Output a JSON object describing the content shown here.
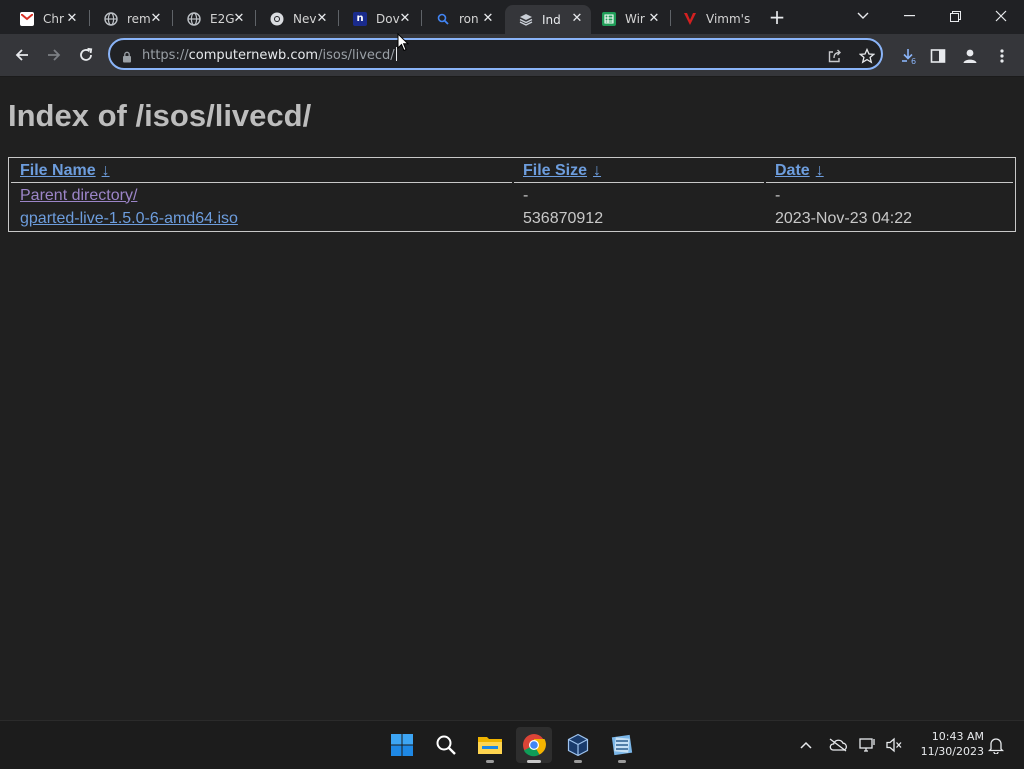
{
  "browser": {
    "tabs": [
      {
        "label": "Chr",
        "icon": "gmail-icon",
        "active": false
      },
      {
        "label": "rem",
        "icon": "globe-icon",
        "active": false
      },
      {
        "label": "E2G",
        "icon": "globe-icon",
        "active": false
      },
      {
        "label": "Nev",
        "icon": "chrome-icon",
        "active": false
      },
      {
        "label": "Dov",
        "icon": "n-logo-icon",
        "active": false
      },
      {
        "label": "ron",
        "icon": "search-icon",
        "active": false
      },
      {
        "label": "Ind",
        "icon": "site-icon",
        "active": true
      },
      {
        "label": "Wir",
        "icon": "sheet-icon",
        "active": false
      },
      {
        "label": "Vimm's",
        "icon": "vimm-icon",
        "active": false
      }
    ],
    "url_host": "computernewb.com",
    "url_scheme": "https://",
    "url_path": "/isos/livecd/",
    "download_badge": "6"
  },
  "page": {
    "title": "Index of /isos/livecd/",
    "columns": {
      "name": "File Name",
      "size": "File Size",
      "date": "Date",
      "sort_arrow": "↓"
    },
    "rows": [
      {
        "name": "Parent directory/",
        "size": "-",
        "date": "-",
        "visited": true
      },
      {
        "name": "gparted-live-1.5.0-6-amd64.iso",
        "size": "536870912",
        "date": "2023-Nov-23 04:22",
        "visited": false
      }
    ]
  },
  "taskbar": {
    "time": "10:43 AM",
    "date": "11/30/2023",
    "apps": [
      "windows-start-icon",
      "search-icon",
      "file-explorer-icon",
      "chrome-icon",
      "virtualbox-icon",
      "winrar-icon"
    ]
  },
  "colors": {
    "link": "#6d9ddd",
    "visited_link": "#9c85c8",
    "omnibox_focus": "#8ab4f8",
    "page_bg": "#202020"
  }
}
